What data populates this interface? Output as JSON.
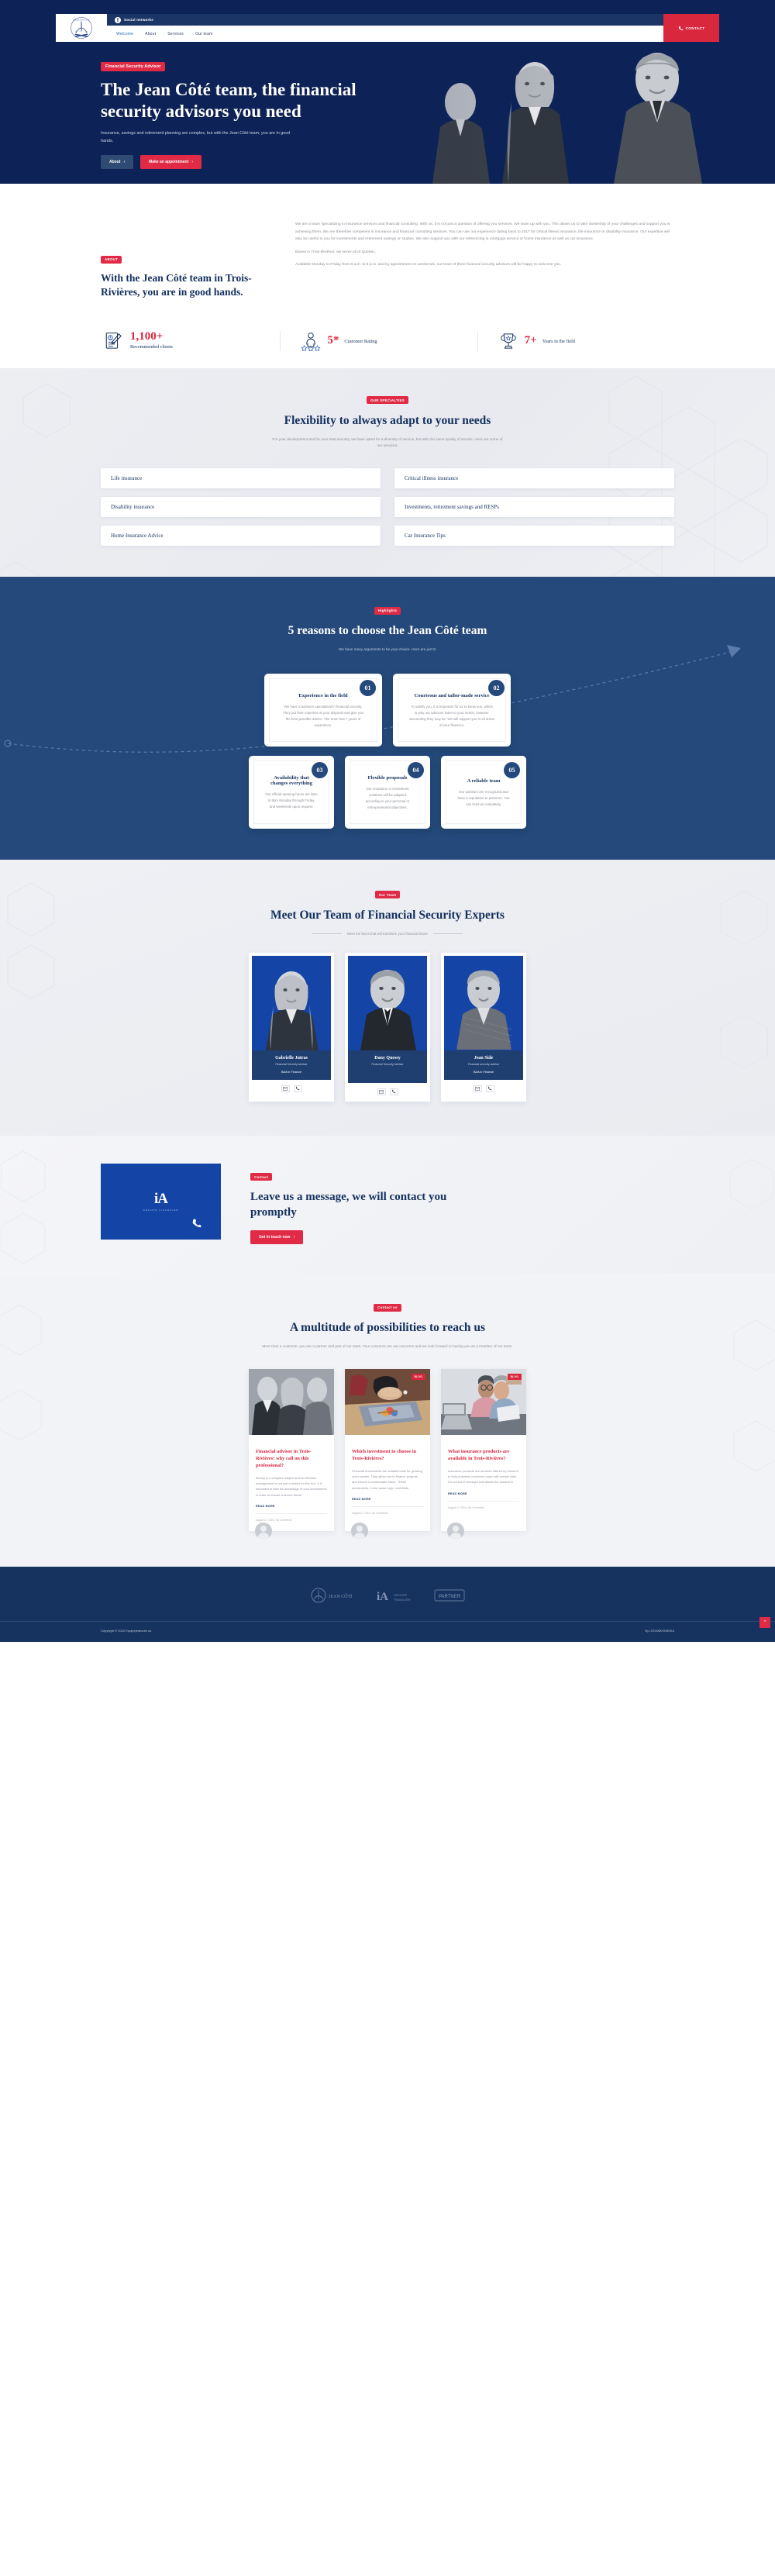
{
  "header": {
    "social_label": "Social networks",
    "facebook_icon": "facebook-icon",
    "nav": [
      {
        "label": "Welcome",
        "active": true
      },
      {
        "label": "About",
        "active": false
      },
      {
        "label": "Services",
        "active": false
      },
      {
        "label": "Our team",
        "active": false
      }
    ],
    "contact_button": "CONTACT",
    "phone_icon": "phone-icon",
    "logo_text": "ÉQUIPE JEAN CÔTÉ"
  },
  "hero": {
    "pill": "Financial Security Advisor",
    "title": "The Jean Côté team, the financial security advisors you need",
    "subtitle": "Insurance, savings and retirement planning are complex, but with the Jean Côté team, you are in good hands.",
    "btn_about": "About",
    "btn_appointment": "Make an appointment"
  },
  "about": {
    "tag": "ABOUT",
    "heading": "With the Jean Côté team in Trois-Rivières, you are in good hands.",
    "paragraphs": [
      "We are a team specializing in insurance services and financial consulting. With us, it is not just a question of offering you services. We team up with you. This allows us to take ownership of your challenges and support you in achieving them. We are therefore competent in insurance and financial consulting services. You can use our experience dating back to 2017 for critical illness insurance, life insurance or disability insurance. Our expertise will also be useful to you for investments and retirement savings or studies. We also support you with our referencing in mortgage service or home insurance as well as car insurance.",
      "Based in Trois-Rivières, we serve all of Quebec.",
      "Available Monday to Friday from 8 a.m. to 8 p.m. and by appointment on weekends, our team of three financial security advisors will be happy to welcome you."
    ]
  },
  "stats": [
    {
      "icon": "document-pen-icon",
      "number": "1,100+",
      "label": "Recommended clients"
    },
    {
      "icon": "person-stars-icon",
      "number": "5*",
      "label": "Customer Rating"
    },
    {
      "icon": "trophy-icon",
      "number": "7+",
      "label": "Years in the field"
    }
  ],
  "specialties": {
    "tag": "OUR SPECIALTIES",
    "title": "Flexibility to always adapt to your needs",
    "subtitle": "For your development and for your total security, we have opted for a diversity of service, but with the same quality of service. Here are some of our services:",
    "items": [
      "Life insurance",
      "Critical illness insurance",
      "Disability insurance",
      "Investments, retirement savings and RESPs",
      "Home Insurance Advice",
      "Car Insurance Tips"
    ]
  },
  "reasons": {
    "tag": "Highlights",
    "title": "5 reasons to choose the Jean Côté team",
    "subtitle": "We have many arguments to be your choice. Here are just 5:",
    "cards": [
      {
        "num": "01",
        "title": "Experience in the field",
        "text": "We have 3 advisors specialized in financial security. They put their expertise at your disposal and give you the best possible advice. The team has 7 years of experience."
      },
      {
        "num": "02",
        "title": "Courteous and tailor-made service",
        "text": "To satisfy you, it is important for us to know you, which is why our advisors listen to your needs, however demanding they may be. We will support you in all areas of your finances."
      },
      {
        "num": "03",
        "title": "Availability that changes everything",
        "text": "Our official opening hours are 8am to 8pm Monday through Friday, and weekends upon request."
      },
      {
        "num": "04",
        "title": "Flexible proposals",
        "text": "Our insurance or investment solutions will be adapted according to your personal or entrepreneurial objectives."
      },
      {
        "num": "05",
        "title": "A reliable team",
        "text": "Our advisors are recognized and have a reputation to preserve. You can trust us completely."
      }
    ]
  },
  "team": {
    "tag": "Our Team",
    "title": "Meet Our Team of Financial Security Experts",
    "divider_text": "Meet the faces that will transform your financial future",
    "members": [
      {
        "name": "Gabrielle Jutras",
        "role": "Financial Security Advisor",
        "degree": "BAA in Finance",
        "mail_icon": "mail-icon",
        "phone_icon": "phone-icon"
      },
      {
        "name": "Dany Quessy",
        "role": "Financial Security Advisor",
        "degree": "",
        "mail_icon": "mail-icon",
        "phone_icon": "phone-icon"
      },
      {
        "name": "Jean Side",
        "role": "Financial security advisor",
        "degree": "BAA in Finance",
        "mail_icon": "mail-icon",
        "phone_icon": "phone-icon"
      }
    ]
  },
  "contact": {
    "tag": "Contact",
    "title": "Leave us a message, we will contact you promptly",
    "button": "Get in touch now",
    "card_logo": "iA",
    "card_sub": "GROUPE FINANCIER",
    "phone_icon": "phone-icon"
  },
  "blog": {
    "tag": "Contact us",
    "title": "A multitude of possibilities to reach us",
    "subtitle": "More than a customer, you are a partner and part of our team. Your concerns are our concerns and we look forward to having you as a member of our team.",
    "badge": "BLOG",
    "read_more": "READ MORE",
    "posts": [
      {
        "title": "Financial advisor in Trois-Rivières: why call on this professional?",
        "excerpt": "Money is a complex subject and its effective management is not just a matter for the rich. It is important to take full advantage of your investments in order to ensure a secure future.",
        "meta": "August 12, 2024  •  No Comments"
      },
      {
        "title": "Which investment to choose in Trois-Rivières?",
        "excerpt": "Financial investments are suitable tools for growing one's assets. They allow one to finance projects and ensure a comfortable future. These investments, in the same logic, contribute",
        "meta": "August 12, 2024  •  No Comments"
      },
      {
        "title": "What insurance products are available in Trois-Rivières?",
        "excerpt": "Insurance products are services offered by insurers to help potential customers cope with certain risks. It is a kind of foresight that allows the insured to",
        "meta": "August 12, 2024  •  No Comments"
      }
    ]
  },
  "footer": {
    "copyright": "Copyright © 2022 Equipejeancote.ca",
    "credit": "By LEDANKOMEDIA",
    "scroll_top_icon": "chevron-up-icon"
  },
  "colors": {
    "navy": "#0d2357",
    "navy_mid": "#24497a",
    "red": "#d9273e",
    "red_accent": "#e12a45",
    "blue_photo": "#1444a5"
  }
}
